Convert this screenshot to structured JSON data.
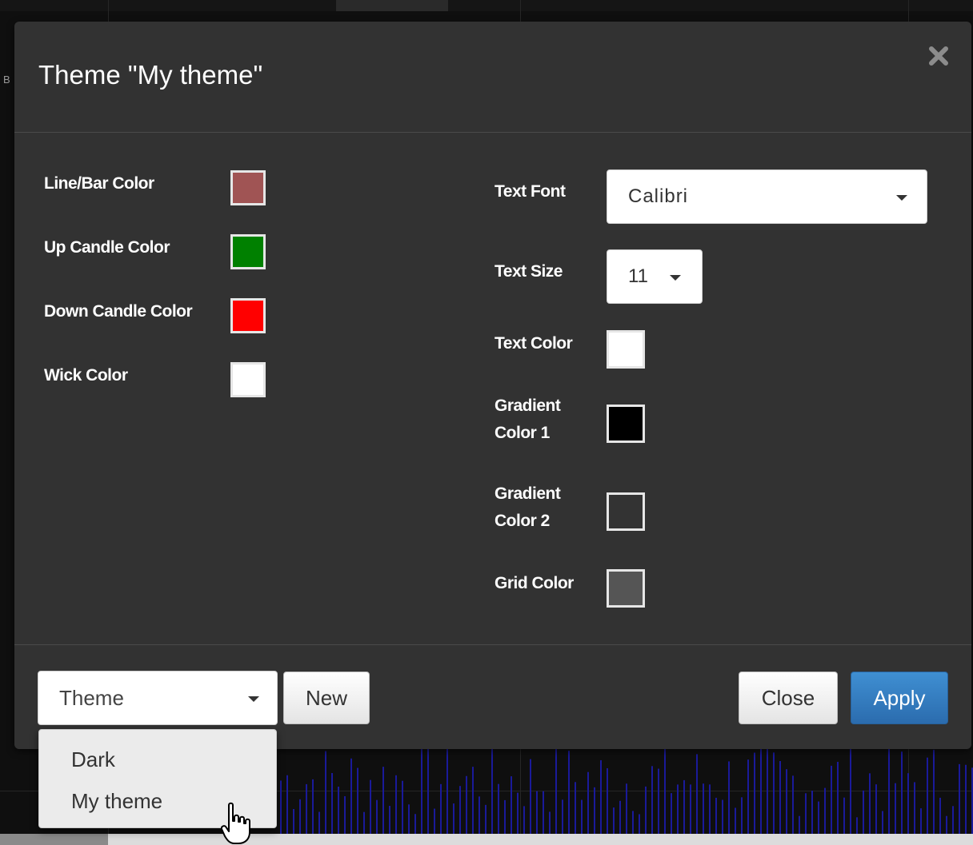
{
  "modal": {
    "title": "Theme \"My theme\"",
    "close_label": "×"
  },
  "left_column": [
    {
      "label": "Line/Bar Color",
      "color": "#a05454"
    },
    {
      "label": "Up Candle Color",
      "color": "#008000"
    },
    {
      "label": "Down Candle Color",
      "color": "#ff0000"
    },
    {
      "label": "Wick Color",
      "color": "#ffffff"
    }
  ],
  "right_column": {
    "text_font": {
      "label": "Text Font",
      "value": "Calibri"
    },
    "text_size": {
      "label": "Text Size",
      "value": "11"
    },
    "text_color": {
      "label": "Text Color",
      "color": "#ffffff"
    },
    "gradient_color_1": {
      "label_line1": "Gradient",
      "label_line2": "Color 1",
      "color": "#000000"
    },
    "gradient_color_2": {
      "label_line1": "Gradient",
      "label_line2": "Color 2",
      "color": "#333333"
    },
    "grid_color": {
      "label": "Grid Color",
      "color": "#555555"
    }
  },
  "footer": {
    "theme_select": {
      "value": "Theme"
    },
    "new_label": "New",
    "close_label": "Close",
    "apply_label": "Apply"
  },
  "theme_dropdown": {
    "items": [
      "Dark",
      "My theme"
    ]
  },
  "colors": {
    "modal_bg": "#323232",
    "primary": "#2f7bc1",
    "chart_bars": "#1a1a9a"
  }
}
